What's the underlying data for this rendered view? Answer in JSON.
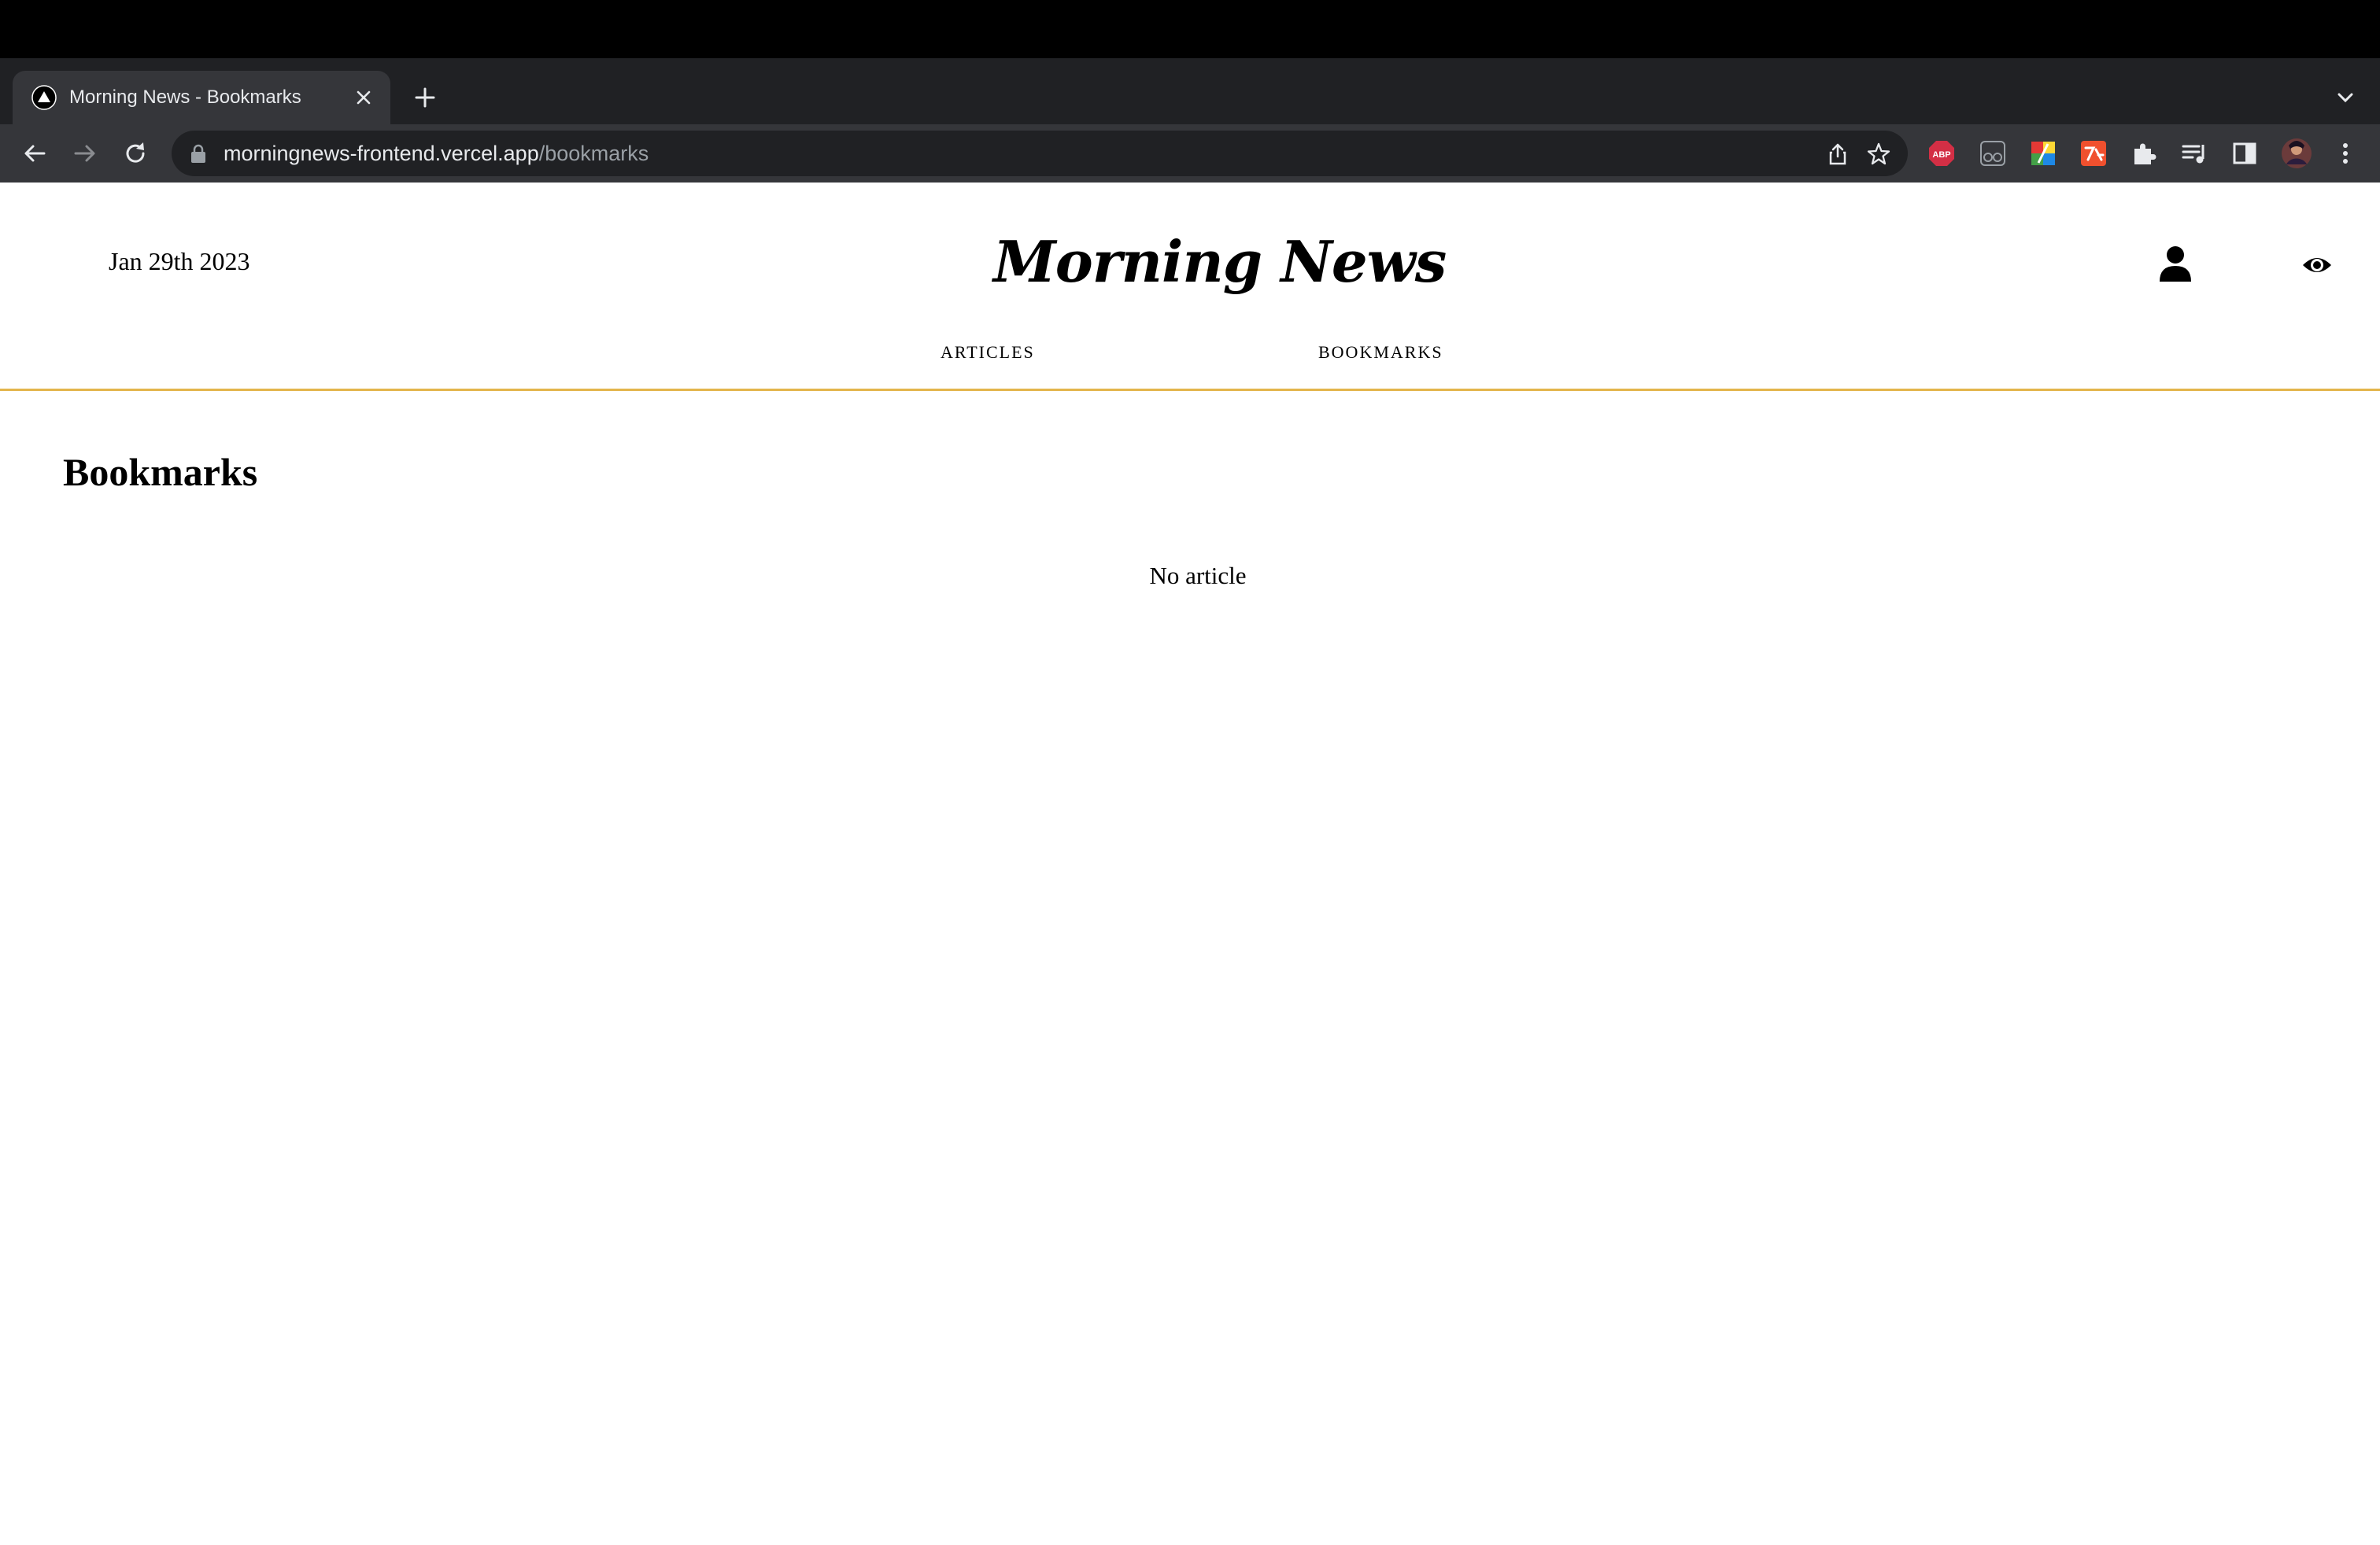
{
  "browser": {
    "tab_title": "Morning News - Bookmarks",
    "url_host": "morningnews-frontend.vercel.app",
    "url_path": "/bookmarks",
    "icons": {
      "favicon": "vercel-triangle-icon",
      "close": "close-icon",
      "new_tab": "plus-icon",
      "tab_menu": "chevron-down-icon",
      "back": "back-arrow-icon",
      "forward": "forward-arrow-icon",
      "reload": "reload-icon",
      "lock": "lock-icon",
      "share": "share-icon",
      "bookmark": "star-icon",
      "adblock": "adblock-extension-icon",
      "reader": "glasses-extension-icon",
      "palette": "color-extension-icon",
      "translate": "translate-extension-icon",
      "extensions": "puzzle-icon",
      "media": "media-control-icon",
      "sidepanel": "side-panel-icon",
      "profile": "profile-avatar-icon",
      "menu": "kebab-menu-icon"
    },
    "adblock_label": "ABP"
  },
  "header": {
    "date": "Jan 29th 2023",
    "logo": "Morning News",
    "nav": {
      "articles": "ARTICLES",
      "bookmarks": "BOOKMARKS"
    },
    "accent_color": "#e3b54c"
  },
  "main": {
    "title": "Bookmarks",
    "empty_message": "No article"
  }
}
